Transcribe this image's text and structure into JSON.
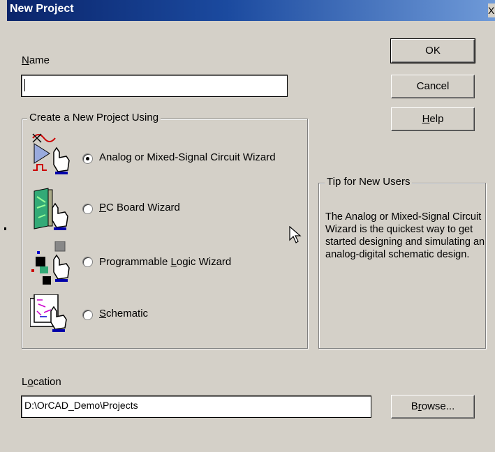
{
  "window": {
    "title": "New Project",
    "close_glyph": "X"
  },
  "name_field": {
    "label_mnemonic": "N",
    "label_rest": "ame",
    "value": ""
  },
  "buttons": {
    "ok": "OK",
    "cancel": "Cancel",
    "help_mnemonic": "H",
    "help_rest": "elp",
    "browse_before": "B",
    "browse_mnemonic": "r",
    "browse_after": "owse..."
  },
  "project_group": {
    "legend": "Create a New Project Using",
    "options": [
      {
        "before": "Analog or Mixed-Signal Circuit Wizard",
        "mnemonic": "",
        "after": "",
        "selected": true,
        "icon": "analog-wizard-icon"
      },
      {
        "before": "",
        "mnemonic": "P",
        "after": "C Board Wizard",
        "selected": false,
        "icon": "pc-board-wizard-icon"
      },
      {
        "before": "Programmable ",
        "mnemonic": "L",
        "after": "ogic Wizard",
        "selected": false,
        "icon": "programmable-logic-wizard-icon"
      },
      {
        "before": "",
        "mnemonic": "S",
        "after": "chematic",
        "selected": false,
        "icon": "schematic-icon"
      }
    ]
  },
  "tip": {
    "legend": "Tip for New Users",
    "text": "The Analog or Mixed-Signal Circuit Wizard is the quickest way to get started designing and simulating an analog-digital schematic design."
  },
  "location": {
    "label_before": "L",
    "label_mnemonic": "o",
    "label_after": "cation",
    "value": "D:\\OrCAD_Demo\\Projects"
  },
  "colors": {
    "dialog_bg": "#d4d0c8",
    "titlebar_start": "#0a246a",
    "titlebar_end": "#6f9ad8"
  }
}
